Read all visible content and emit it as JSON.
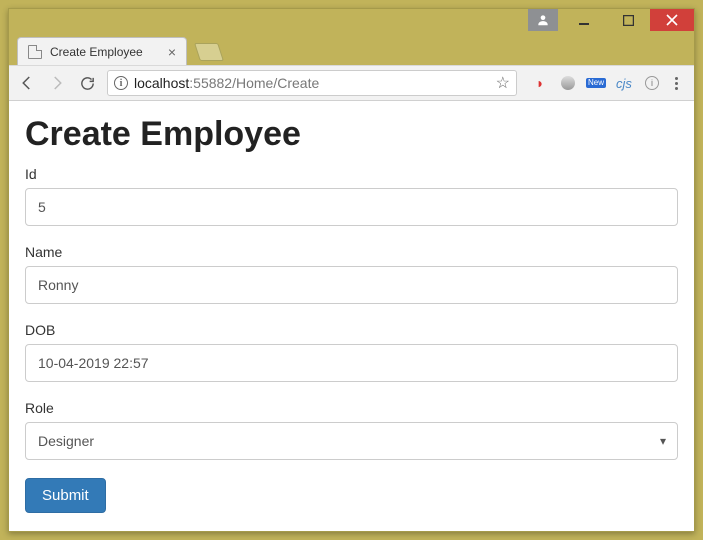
{
  "window": {
    "tab_title": "Create Employee"
  },
  "addressbar": {
    "host": "localhost",
    "port": ":55882",
    "path": "/Home/Create"
  },
  "extensions": {
    "new_badge": "New",
    "cjs": "cjs",
    "info_badge": "i"
  },
  "page": {
    "heading": "Create Employee",
    "form": {
      "id_label": "Id",
      "id_value": "5",
      "name_label": "Name",
      "name_value": "Ronny",
      "dob_label": "DOB",
      "dob_value": "10-04-2019 22:57",
      "role_label": "Role",
      "role_value": "Designer",
      "submit_label": "Submit"
    }
  }
}
